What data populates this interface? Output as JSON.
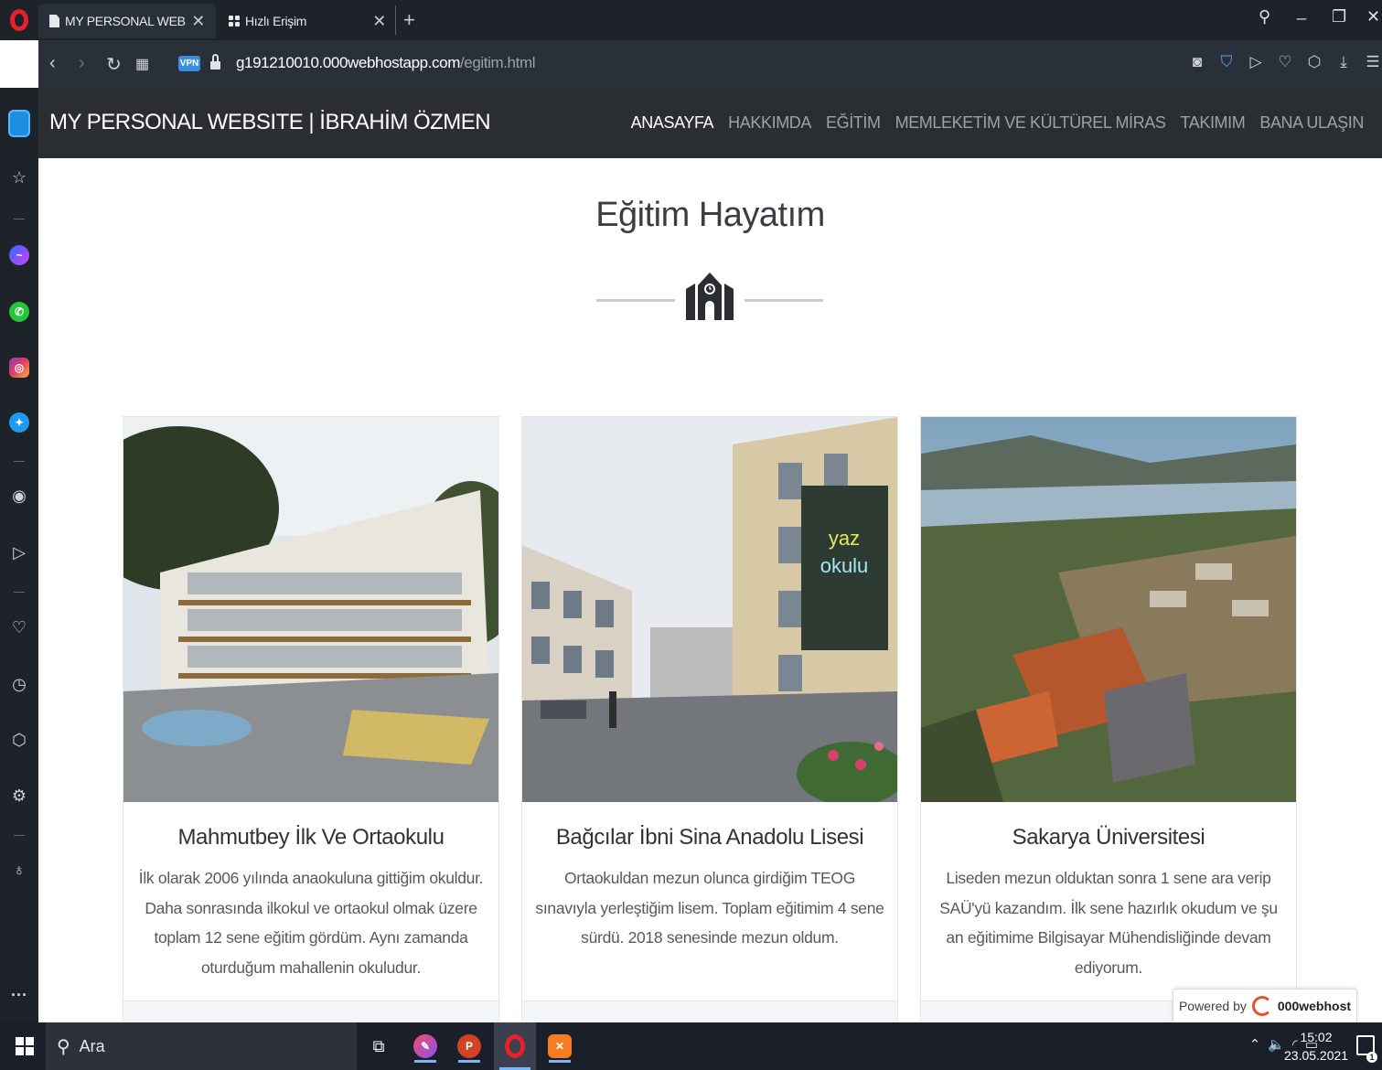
{
  "browser": {
    "tabs": [
      {
        "title": "MY PERSONAL WEBSITE | İ",
        "active": true
      },
      {
        "title": "Hızlı Erişim",
        "active": false
      }
    ],
    "url_host": "g191210010.000webhostapp.com",
    "url_path": "/egitim.html",
    "vpn_label": "VPN"
  },
  "site": {
    "brand": "MY PERSONAL WEBSITE | İBRAHİM ÖZMEN",
    "nav": [
      {
        "label": "ANASAYFA",
        "active": true
      },
      {
        "label": "HAKKIMDA",
        "active": false
      },
      {
        "label": "EĞİTİM",
        "active": false
      },
      {
        "label": "MEMLEKETİM VE KÜLTÜREL MİRAS",
        "active": false
      },
      {
        "label": "TAKIMIM",
        "active": false
      },
      {
        "label": "BANA ULAŞIN",
        "active": false
      }
    ],
    "page_title": "Eğitim Hayatım",
    "divider_icon": "school-building-icon",
    "cards": [
      {
        "title": "Mahmutbey İlk Ve Ortaokulu",
        "text": "İlk olarak 2006 yılında anaokuluna gittiğim okuldur. Daha sonrasında ilkokul ve ortaokul olmak üzere toplam 12 sene eğitim gördüm. Aynı zamanda oturduğum mahallenin okuludur.",
        "photo": "school-building-photo"
      },
      {
        "title": "Bağcılar İbni Sina Anadolu Lisesi",
        "text": "Ortaokuldan mezun olunca girdiğim TEOG sınavıyla yerleştiğim lisem. Toplam eğitimim 4 sene sürdü. 2018 senesinde mezun oldum.",
        "photo": "high-school-photo"
      },
      {
        "title": "Sakarya Üniversitesi",
        "text": "Liseden mezun olduktan sonra 1 sene ara verip SAÜ'yü kazandım. İlk sene hazırlık okudum ve şu an eğitimime Bilgisayar Mühendisliğinde devam ediyorum.",
        "photo": "university-aerial-photo"
      }
    ],
    "powered_by": "Powered by",
    "powered_brand": "000webhost"
  },
  "taskbar": {
    "search_placeholder": "Ara",
    "time": "15:02",
    "date": "23.05.2021",
    "notification_count": "1"
  },
  "colors": {
    "nav_bg": "#2b2e31",
    "browser_bg": "#1e232a",
    "taskbar_bg": "#1b1f29",
    "accent_opera": "#e8202c"
  }
}
